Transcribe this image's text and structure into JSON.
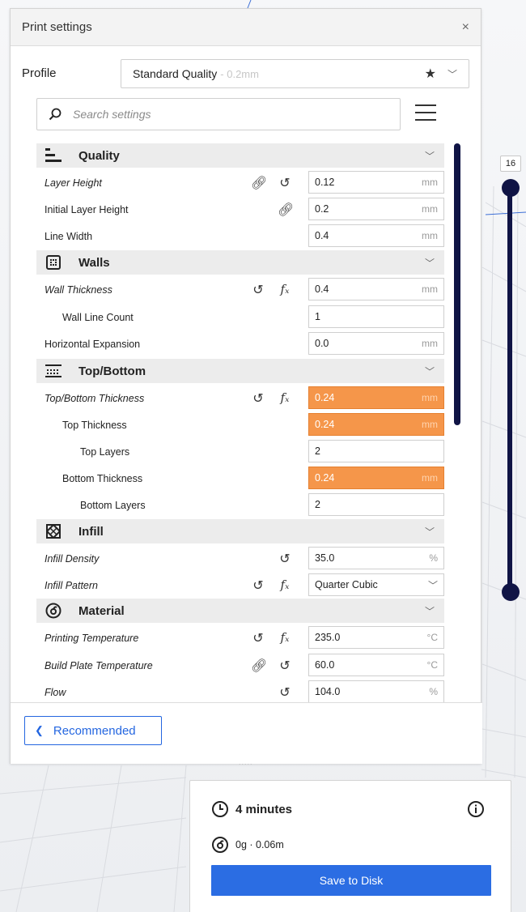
{
  "panel": {
    "title": "Print settings",
    "close_glyph": "×",
    "profile_label": "Profile",
    "profile_value": "Standard Quality",
    "profile_sub": " - 0.2mm",
    "search_placeholder": "Search settings",
    "recommended_label": "Recommended",
    "grip": "....."
  },
  "categories": {
    "quality": "Quality",
    "walls": "Walls",
    "topbottom": "Top/Bottom",
    "infill": "Infill",
    "material": "Material"
  },
  "settings": {
    "layer_height": {
      "label": "Layer Height",
      "value": "0.12",
      "unit": "mm"
    },
    "initial_layer_height": {
      "label": "Initial Layer Height",
      "value": "0.2",
      "unit": "mm"
    },
    "line_width": {
      "label": "Line Width",
      "value": "0.4",
      "unit": "mm"
    },
    "wall_thickness": {
      "label": "Wall Thickness",
      "value": "0.4",
      "unit": "mm"
    },
    "wall_line_count": {
      "label": "Wall Line Count",
      "value": "1"
    },
    "horizontal_expansion": {
      "label": "Horizontal Expansion",
      "value": "0.0",
      "unit": "mm"
    },
    "top_bottom_thickness": {
      "label": "Top/Bottom Thickness",
      "value": "0.24",
      "unit": "mm"
    },
    "top_thickness": {
      "label": "Top Thickness",
      "value": "0.24",
      "unit": "mm"
    },
    "top_layers": {
      "label": "Top Layers",
      "value": "2"
    },
    "bottom_thickness": {
      "label": "Bottom Thickness",
      "value": "0.24",
      "unit": "mm"
    },
    "bottom_layers": {
      "label": "Bottom Layers",
      "value": "2"
    },
    "infill_density": {
      "label": "Infill Density",
      "value": "35.0",
      "unit": "%"
    },
    "infill_pattern": {
      "label": "Infill Pattern",
      "value": "Quarter Cubic"
    },
    "printing_temperature": {
      "label": "Printing Temperature",
      "value": "235.0",
      "unit": "°C"
    },
    "build_plate_temperature": {
      "label": "Build Plate Temperature",
      "value": "60.0",
      "unit": "°C"
    },
    "flow": {
      "label": "Flow",
      "value": "104.0",
      "unit": "%"
    }
  },
  "layer_slider": {
    "top_value": "16"
  },
  "output": {
    "time": "4 minutes",
    "material": "0g · 0.06m",
    "save_label": "Save to Disk"
  },
  "colors": {
    "accent": "#2b6de3",
    "warning": "#f5964a",
    "slider": "#101445"
  }
}
